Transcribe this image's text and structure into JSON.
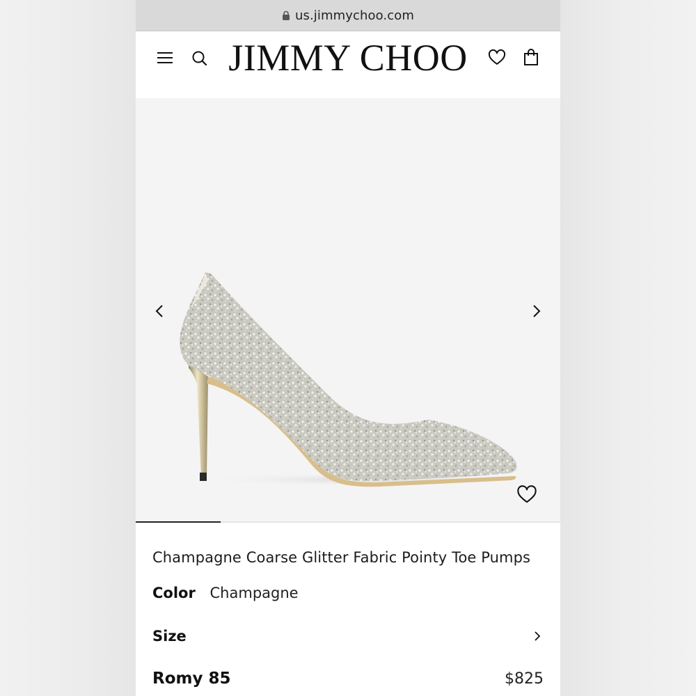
{
  "browser": {
    "url": "us.jimmychoo.com"
  },
  "header": {
    "logo": "JIMMY CHOO",
    "icons": [
      "menu-icon",
      "search-icon",
      "heart-icon",
      "shopping-bag-icon"
    ]
  },
  "gallery": {
    "image_count_hint": 5,
    "active_index": 0,
    "icons": [
      "chevron-left-icon",
      "chevron-right-icon",
      "heart-icon"
    ]
  },
  "product": {
    "title": "Champagne Coarse Glitter Fabric Pointy Toe Pumps",
    "color_label": "Color",
    "color_value": "Champagne",
    "size_label": "Size",
    "model_name": "Romy 85",
    "price": "$825"
  },
  "colors": {
    "url_bar": "#d9d9d9",
    "gallery_bg": "#f4f4f4",
    "text": "#111111",
    "glitter": "#cfcfc8",
    "heel_gold": "#c9b98a",
    "lining": "#e3c28f"
  }
}
